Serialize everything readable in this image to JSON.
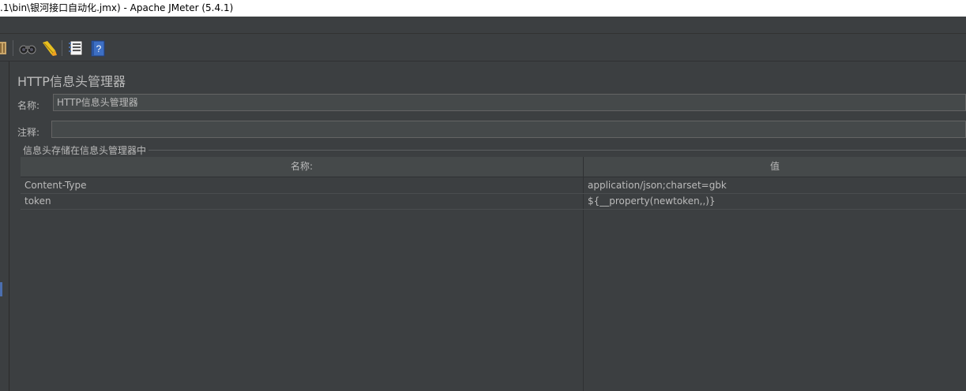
{
  "window": {
    "title": ".1\\bin\\银河接口自动化.jmx) - Apache JMeter (5.4.1)"
  },
  "toolbar": {
    "icons": [
      "broom-icon",
      "binoculars-icon",
      "clear-icon",
      "log-list-icon",
      "help-icon"
    ]
  },
  "panel": {
    "title": "HTTP信息头管理器",
    "name_label": "名称:",
    "name_value": "HTTP信息头管理器",
    "comment_label": "注释:",
    "comment_value": "",
    "group_title": "信息头存储在信息头管理器中"
  },
  "table": {
    "columns": [
      "名称:",
      "值"
    ],
    "rows": [
      {
        "name": "Content-Type",
        "value": "application/json;charset=gbk"
      },
      {
        "name": "token",
        "value": "${__property(newtoken,,)}"
      }
    ]
  }
}
